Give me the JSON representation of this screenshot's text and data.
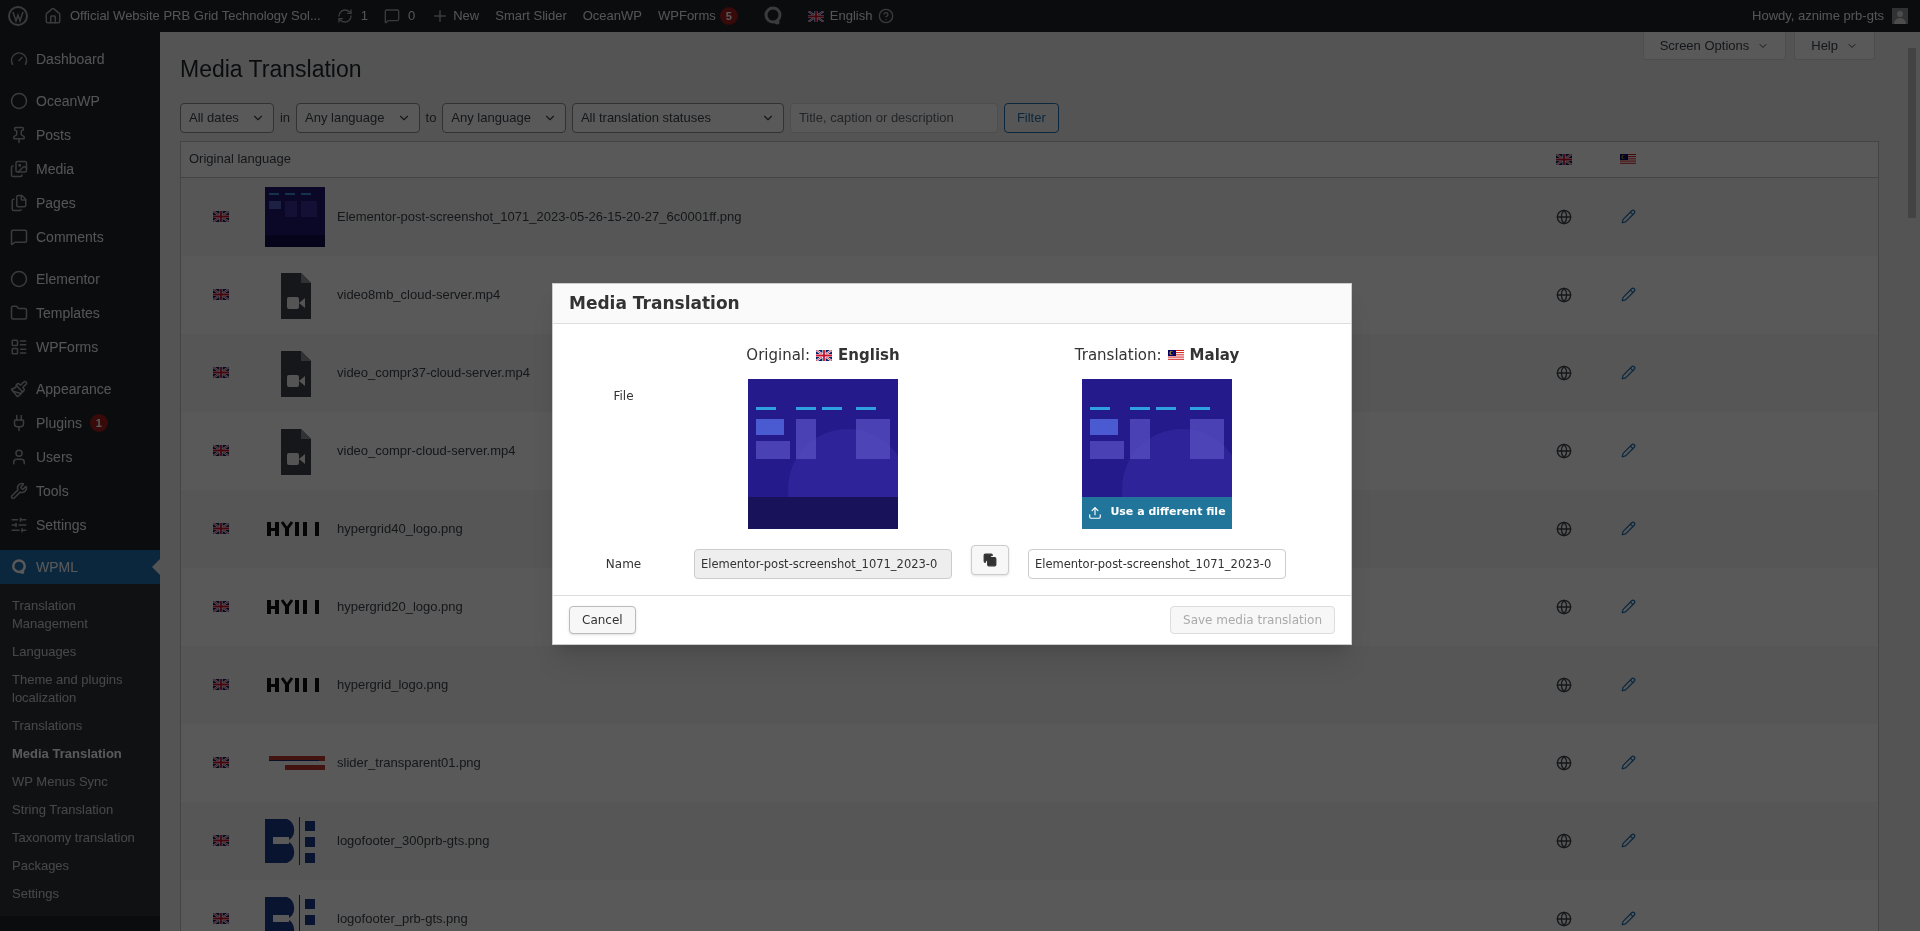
{
  "admin_bar": {
    "site_title": "Official Website PRB Grid Technology Sol...",
    "updates": "1",
    "comments": "0",
    "new": "New",
    "links": [
      "Smart Slider",
      "OceanWP"
    ],
    "wpforms": {
      "label": "WPForms",
      "count": "5"
    },
    "language": "English",
    "howdy": "Howdy, aznime prb-gts"
  },
  "sidebar": {
    "groups": [
      [
        {
          "label": "Dashboard"
        }
      ],
      [
        {
          "label": "OceanWP"
        },
        {
          "label": "Posts"
        },
        {
          "label": "Media"
        },
        {
          "label": "Pages"
        },
        {
          "label": "Comments"
        }
      ],
      [
        {
          "label": "Elementor"
        },
        {
          "label": "Templates"
        },
        {
          "label": "WPForms"
        }
      ],
      [
        {
          "label": "Appearance"
        },
        {
          "label": "Plugins",
          "badge": "1"
        },
        {
          "label": "Users"
        },
        {
          "label": "Tools"
        },
        {
          "label": "Settings"
        }
      ]
    ],
    "current": {
      "label": "WPML"
    },
    "submenu": [
      {
        "label": "Translation Management",
        "selected": false
      },
      {
        "label": "Languages",
        "selected": false
      },
      {
        "label": "Theme and plugins localization",
        "selected": false
      },
      {
        "label": "Translations",
        "selected": false
      },
      {
        "label": "Media Translation",
        "selected": true
      },
      {
        "label": "WP Menus Sync",
        "selected": false
      },
      {
        "label": "String Translation",
        "selected": false
      },
      {
        "label": "Taxonomy translation",
        "selected": false
      },
      {
        "label": "Packages",
        "selected": false
      },
      {
        "label": "Settings",
        "selected": false
      }
    ]
  },
  "screen_buttons": [
    "Screen Options",
    "Help"
  ],
  "page_title": "Media Translation",
  "filters": {
    "dates": "All dates",
    "in": "in",
    "from_language": "Any language",
    "to": "to",
    "to_language": "Any language",
    "status": "All translation statuses",
    "search_placeholder": "Title, caption or description",
    "button": "Filter"
  },
  "table": {
    "header": "Original language",
    "rows": [
      {
        "file": "Elementor-post-screenshot_1071_2023-05-26-15-20-27_6c0001ff.png",
        "kind": "screenshot"
      },
      {
        "file": "video8mb_cloud-server.mp4",
        "kind": "video"
      },
      {
        "file": "video_compr37-cloud-server.mp4",
        "kind": "video"
      },
      {
        "file": "video_compr-cloud-server.mp4",
        "kind": "video"
      },
      {
        "file": "hypergrid40_logo.png",
        "kind": "logo"
      },
      {
        "file": "hypergrid20_logo.png",
        "kind": "logo"
      },
      {
        "file": "hypergrid_logo.png",
        "kind": "logo"
      },
      {
        "file": "slider_transparent01.png",
        "kind": "slider"
      },
      {
        "file": "logofooter_300prb-gts.png",
        "kind": "footer"
      },
      {
        "file": "logofooter_prb-gts.png",
        "kind": "footer"
      }
    ]
  },
  "modal": {
    "title": "Media Translation",
    "original_label": "Original:",
    "original_language": "English",
    "translation_label": "Translation:",
    "translation_language": "Malay",
    "file_label": "File",
    "name_label": "Name",
    "original_name": "Elementor-post-screenshot_1071_2023-0",
    "translated_name": "Elementor-post-screenshot_1071_2023-0",
    "upload_button": "Use a different file",
    "cancel": "Cancel",
    "save": {
      "label": "Save media translation",
      "disabled": true
    }
  }
}
